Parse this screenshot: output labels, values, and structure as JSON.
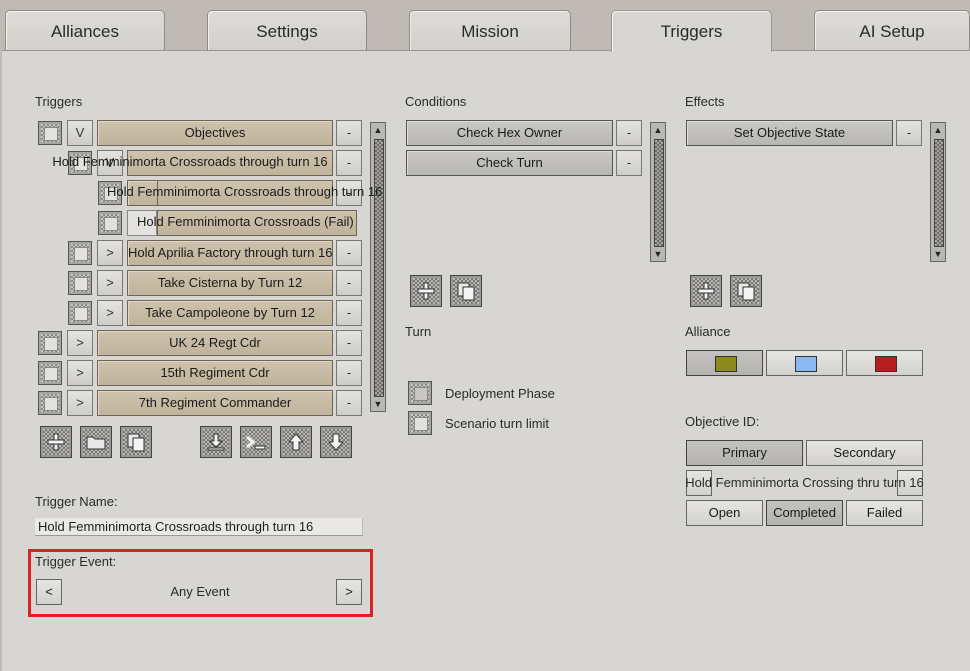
{
  "tabs": [
    {
      "label": "Alliances"
    },
    {
      "label": "Settings"
    },
    {
      "label": "Mission"
    },
    {
      "label": "Triggers"
    },
    {
      "label": "AI Setup"
    }
  ],
  "triggers": {
    "heading": "Triggers",
    "items": [
      {
        "expander": "V",
        "label": "Objectives",
        "remove": "-"
      },
      {
        "expander": "V",
        "label": "Hold Femminimorta Crossroads through turn 16",
        "remove": "-"
      },
      {
        "expander": "",
        "label": "Hold Femminimorta Crossroads through turn 16",
        "remove": "-"
      },
      {
        "expander": "",
        "label": "Hold Femminimorta Crossroads (Fail)",
        "remove": "-"
      },
      {
        "expander": ">",
        "label": "Hold Aprilia Factory through turn 16",
        "remove": "-"
      },
      {
        "expander": ">",
        "label": "Take  Cisterna by Turn 12",
        "remove": "-"
      },
      {
        "expander": ">",
        "label": "Take Campoleone by Turn 12",
        "remove": "-"
      },
      {
        "expander": ">",
        "label": "UK 24 Regt Cdr",
        "remove": "-"
      },
      {
        "expander": ">",
        "label": "15th Regiment Cdr",
        "remove": "-"
      },
      {
        "expander": ">",
        "label": "7th Regiment Commander",
        "remove": "-"
      }
    ],
    "name_label": "Trigger Name:",
    "name_value": "Hold Femminimorta Crossroads through turn 16",
    "event_label": "Trigger Event:",
    "event_value": "Any Event",
    "event_prev": "<",
    "event_next": ">"
  },
  "conditions": {
    "heading": "Conditions",
    "items": [
      {
        "label": "Check Hex Owner",
        "remove": "-"
      },
      {
        "label": "Check Turn",
        "remove": "-"
      }
    ],
    "turn_label": "Turn",
    "options": [
      {
        "label": "Deployment Phase"
      },
      {
        "label": "Scenario turn limit"
      }
    ]
  },
  "effects": {
    "heading": "Effects",
    "items": [
      {
        "label": "Set Objective State",
        "remove": "-"
      }
    ],
    "alliance_label": "Alliance",
    "alliance_colors": [
      "#8a8a1e",
      "#8ab8f0",
      "#b41e1e"
    ],
    "objective_id_label": "Objective ID:",
    "primary": "Primary",
    "secondary": "Secondary",
    "objective_name": "Hold Femminimorta Crossing thru turn 16",
    "states": [
      "Open",
      "Completed",
      "Failed"
    ]
  },
  "icons": {
    "add": "plus-icon",
    "copy": "copy-icon",
    "folder": "folder-icon",
    "import": "download-icon",
    "console": "console-icon",
    "up": "arrow-up-icon",
    "down": "arrow-down-icon"
  },
  "highlight_color": "#e02020"
}
